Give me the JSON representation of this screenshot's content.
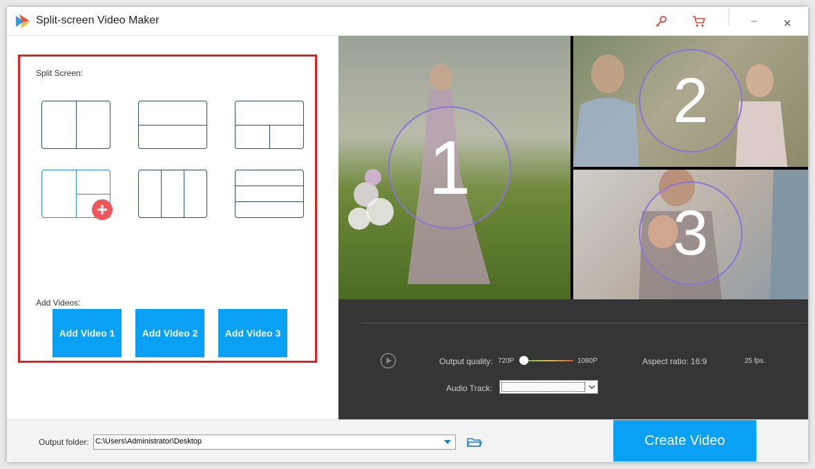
{
  "window": {
    "title": "Split-screen Video Maker",
    "icons": {
      "app": "app-logo-icon",
      "key": "key-icon",
      "cart": "cart-icon",
      "minimize": "minimize-icon",
      "close": "close-icon"
    },
    "minimize_glyph": "–",
    "close_glyph": "✕"
  },
  "left": {
    "split_screen_label": "Split Screen:",
    "add_videos_label": "Add Videos:",
    "add_video_buttons": [
      "Add Video 1",
      "Add Video 2",
      "Add Video 3"
    ],
    "layouts": [
      "two-columns",
      "two-rows",
      "top-plus-two-bottom",
      "left-plus-two-right-custom",
      "three-columns",
      "three-rows"
    ]
  },
  "preview": {
    "cells": [
      "1",
      "2",
      "3"
    ]
  },
  "controls": {
    "output_quality_label": "Output quality:",
    "quality_min": "720P",
    "quality_max": "1080P",
    "quality_value_fraction": 0,
    "aspect_ratio": "Aspect ratio: 16:9",
    "fps": "25 fps.",
    "audio_track_label": "Audio Track:",
    "audio_track_value": ""
  },
  "bottom": {
    "output_folder_label": "Output folder:",
    "output_folder_value": "C:\\Users\\Administrator\\Desktop",
    "create_video_label": "Create Video"
  },
  "colors": {
    "accent": "#0aa1f4",
    "highlight_box": "#e02020",
    "plus_badge": "#f0575b",
    "circle_ring": "#8a74d6",
    "control_bg": "#353535"
  }
}
